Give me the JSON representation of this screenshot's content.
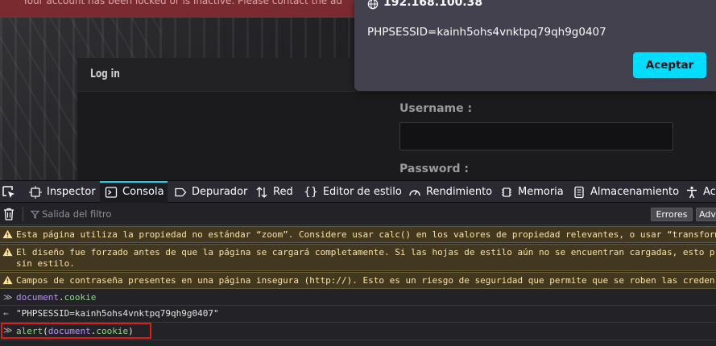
{
  "page": {
    "alert_banner": "Your account has been locked or is inactive. Please contact the ad",
    "login": {
      "title": "Log in",
      "username_label": "Username :",
      "password_label": "Password :"
    }
  },
  "dialog": {
    "host": "192.168.100.38",
    "message": "PHPSESSID=kainh5ohs4vnktpq79qh9g0407",
    "accept_label": "Aceptar"
  },
  "devtools": {
    "tabs": [
      {
        "label": "Inspector",
        "icon": "inspector-icon"
      },
      {
        "label": "Consola",
        "icon": "console-icon"
      },
      {
        "label": "Depurador",
        "icon": "debugger-icon"
      },
      {
        "label": "Red",
        "icon": "network-icon"
      },
      {
        "label": "Editor de estilo",
        "icon": "style-editor-icon"
      },
      {
        "label": "Rendimiento",
        "icon": "performance-icon"
      },
      {
        "label": "Memoria",
        "icon": "memory-icon"
      },
      {
        "label": "Almacenamiento",
        "icon": "storage-icon"
      },
      {
        "label": "Acc",
        "icon": "accessibility-icon"
      }
    ],
    "selected_tab": "Consola",
    "filter_placeholder": "Salida del filtro",
    "errors_label": "Errores",
    "adv_label": "Adv",
    "messages": [
      {
        "type": "warning",
        "text": "Esta página utiliza la propiedad no estándar “zoom”. Considere usar calc() en los valores de propiedad relevantes, o usar “transform”"
      },
      {
        "type": "warning",
        "text": "El diseño fue forzado antes de que la página se cargará completamente. Si las hojas de estilo aún no se encuentran cargadas, esto p",
        "text2": "sin estilo."
      },
      {
        "type": "warning",
        "text": "Campos de contraseña presentes en una página insegura (http://). Esto es un riesgo de seguridad que permite que se roben las creden"
      },
      {
        "type": "input",
        "obj": "document",
        "dot": ".",
        "prop": "cookie"
      },
      {
        "type": "output",
        "text": "\"PHPSESSID=kainh5ohs4vnktpq79qh9g0407\""
      },
      {
        "type": "input",
        "fn": "alert",
        "open": "(",
        "obj": "document",
        "dot": ".",
        "prop": "cookie",
        "close": ")"
      }
    ]
  },
  "colors": {
    "accent": "#00ddff",
    "warning_bg": "#42381f",
    "highlight_box": "#e01b1b"
  }
}
